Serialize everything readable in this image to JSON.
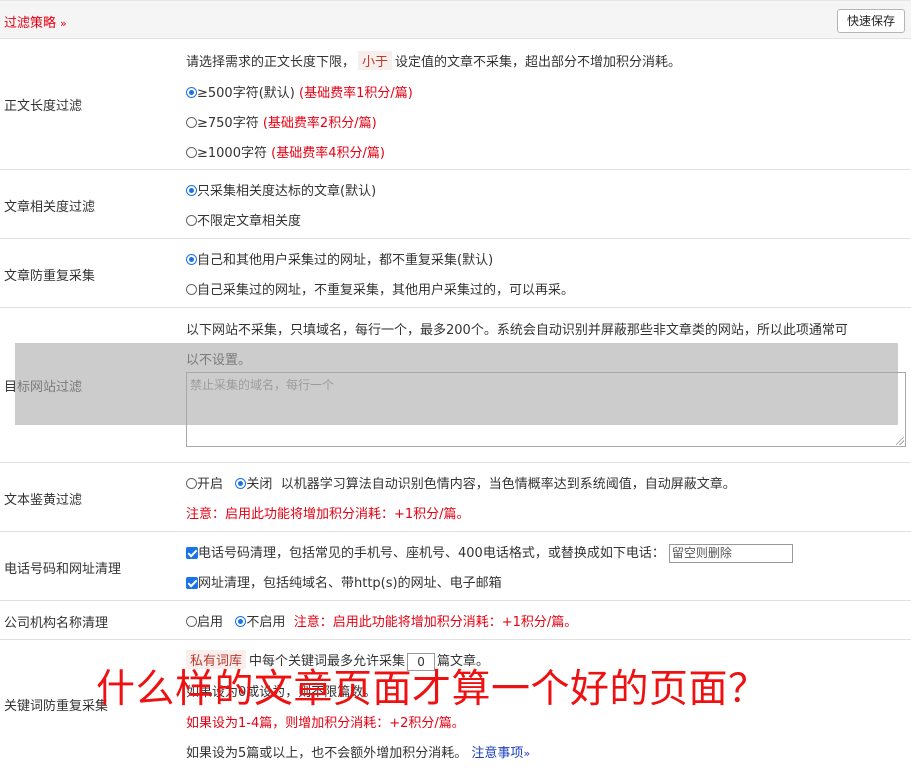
{
  "header": {
    "title": "过滤策略",
    "chevron": "»",
    "save_button": "快速保存"
  },
  "length_filter": {
    "label": "正文长度过滤",
    "desc_pre": "请选择需求的正文长度下限，",
    "desc_tag": "小于",
    "desc_post": "设定值的文章不采集，超出部分不增加积分消耗。",
    "options": [
      {
        "text": "≥500字符(默认)",
        "note": "(基础费率1积分/篇)",
        "selected": true
      },
      {
        "text": "≥750字符",
        "note": "(基础费率2积分/篇)",
        "selected": false
      },
      {
        "text": "≥1000字符",
        "note": "(基础费率4积分/篇)",
        "selected": false
      }
    ]
  },
  "relevance": {
    "label": "文章相关度过滤",
    "options": [
      {
        "text": "只采集相关度达标的文章(默认)",
        "selected": true
      },
      {
        "text": "不限定文章相关度",
        "selected": false
      }
    ]
  },
  "dedupe": {
    "label": "文章防重复采集",
    "options": [
      {
        "text": "自己和其他用户采集过的网址，都不重复采集(默认)",
        "selected": true
      },
      {
        "text": "自己采集过的网址，不重复采集，其他用户采集过的，可以再采。",
        "selected": false
      }
    ]
  },
  "site_filter": {
    "label": "目标网站过滤",
    "desc_line1": "以下网站不采集，只填域名，每行一个，最多200个。系统会自动识别并屏蔽那些非文章类的网站，所以此项通常可",
    "desc_line2": "以不设置。",
    "placeholder": "禁止采集的域名，每行一个"
  },
  "porn_filter": {
    "label": "文本鉴黄过滤",
    "on_text": "开启",
    "off_text": "关闭",
    "desc": "以机器学习算法自动识别色情内容，当色情概率达到系统阈值，自动屏蔽文章。",
    "note": "注意：启用此功能将增加积分消耗：+1积分/篇。"
  },
  "phone_url": {
    "label": "电话号码和网址清理",
    "phone_text": "电话号码清理，包括常见的手机号、座机号、400电话格式，或替换成如下电话：",
    "phone_placeholder": "留空则删除",
    "url_text": "网址清理，包括纯域名、带http(s)的网址、电子邮箱"
  },
  "company": {
    "label": "公司机构名称清理",
    "on_text": "启用",
    "off_text": "不启用",
    "note": "注意：启用此功能将增加积分消耗：+1积分/篇。"
  },
  "keyword_dedupe": {
    "label": "关键词防重复采集",
    "tag": "私有词库",
    "line1_pre": "中每个关键词最多允许采集",
    "count": "0",
    "line1_post": "篇文章。",
    "line2": "如果设为0或设为，则不限篇数。",
    "line3": "如果设为1-4篇，则增加积分消耗：+2积分/篇。",
    "line4": "如果设为5篇或以上，也不会额外增加积分消耗。",
    "link": "注意事项",
    "link_chevron": "»"
  },
  "overlay_caption": "什么样的文章页面才算一个好的页面？"
}
